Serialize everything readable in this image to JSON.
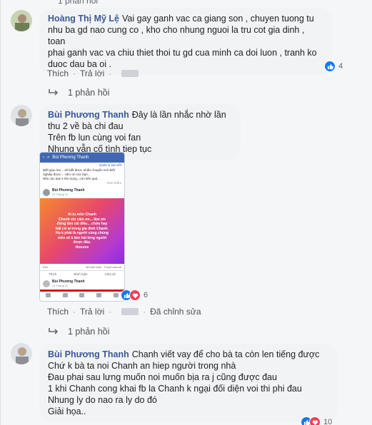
{
  "top_fragment": "1 phản hồi",
  "comments": [
    {
      "name": "Hoàng Thị Mỹ Lệ",
      "lines": [
        "Vai gay ganh vac ca giang son , chuyen tuong tu",
        "nhu ba gd nao cung co , kho cho nhung nguoi la tru cot gia dinh , toan",
        "phai ganh vac va chiu thiet thoi tu gd cua minh ca doi luon , tranh ko",
        "duoc dau ba oi ."
      ],
      "like_label": "Thích",
      "reply_label": "Trả lời",
      "reaction_count": "4",
      "replies_label": "1 phản hồi"
    },
    {
      "name": "Bùi Phương Thanh",
      "lines": [
        "Đây là lần nhắc nhờ lần thu 2 về bà chi đau",
        "Trên fb lun cùng voi fan",
        "Nhung vẫn cố tình tiep tục"
      ],
      "like_label": "Thích",
      "reply_label": "Trả lời",
      "edited_label": "Đã chỉnh sửa",
      "reaction_count": "6",
      "replies_label": "1 phản hồi",
      "screenshot": {
        "header_name": "Bùi Phương Thanh",
        "manage_label": "Quản lý bài viết",
        "intro_lines": [
          "Biết giao lưu... sẽ biết được nhiều chuyện mới biết",
          "nghiệp được... cảm ơn các bạn...",
          "Nếu các bạn k tồn trọng...còn tiền quá..."
        ],
        "see_more": "Xem thêm",
        "poster_name": "Bùi Phương Thanh",
        "poster_time": "23 Tháng 11",
        "poster_lines": [
          "Ai tu mồn Chanh",
          "Chanh xin cảm ơn... lâm ơn",
          "đừng làm cái điều... chứu hay",
          "bất cứ ai trong gia đình Chanh.",
          "Họ k phải là người cùng chúng",
          "mến sẽ k làm hài lòng người",
          "được đâu.",
          "tksssss"
        ],
        "reactions_left": "639",
        "comments_count": "98 bình luận",
        "shares_count": "3 lượt chia sẻ",
        "like_btn": "Thích",
        "comment_btn": "Bình luận",
        "share_btn": "Chia sẻ",
        "poster2_name": "Bùi Phương Thanh",
        "poster2_time": "24 Tháng 11"
      }
    },
    {
      "name": "Bùi Phương Thanh",
      "lines": [
        "Chanh viết vay để cho bà ta còn len tiếng được",
        "Chứ k bà ta noi Chanh an hiep người trong nhà",
        "Đau phai sau lưng muốn noi muốn bịa ra j cũng được đau",
        "1 khi Chanh cong khai fb la Chanh k ngại đối diện voi thi phi đau",
        "Nhung ly do nao ra ly do đó",
        "Giải họa.."
      ],
      "reaction_count": "10"
    }
  ],
  "colors": {
    "name": "#385898",
    "bubble": "#f2f3f5",
    "like": "#1877f2",
    "love": "#f33e58"
  }
}
